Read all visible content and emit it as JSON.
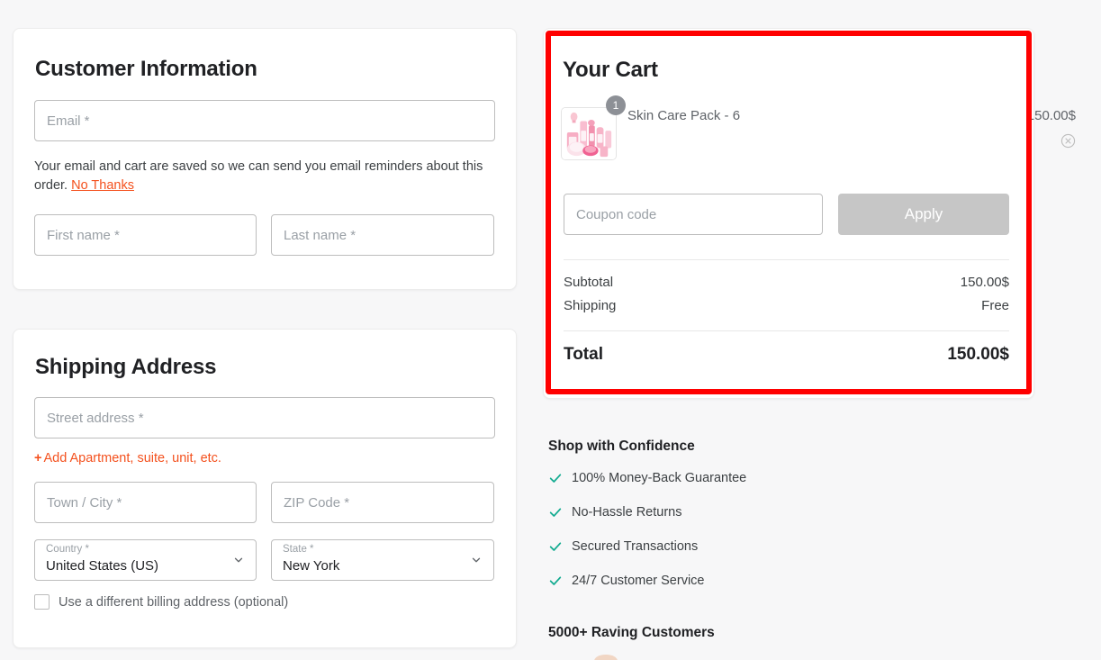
{
  "customer": {
    "title": "Customer Information",
    "email_placeholder": "Email *",
    "email_value": "",
    "help_text": "Your email and cart are saved so we can send you email reminders about this order. ",
    "help_link": "No Thanks",
    "first_name_placeholder": "First name *",
    "first_name_value": "",
    "last_name_placeholder": "Last name *",
    "last_name_value": ""
  },
  "shipping": {
    "title": "Shipping Address",
    "street_placeholder": "Street address *",
    "street_value": "",
    "add_apartment_label": "Add Apartment, suite, unit, etc.",
    "add_apartment_plus": "+",
    "city_placeholder": "Town / City *",
    "city_value": "",
    "zip_placeholder": "ZIP Code *",
    "zip_value": "",
    "country_label": "Country *",
    "country_value": "United States (US)",
    "state_label": "State *",
    "state_value": "New York",
    "billing_checkbox_label": "Use a different billing address (optional)",
    "billing_checked": false
  },
  "cart": {
    "title": "Your Cart",
    "items": [
      {
        "name": "Skin Care Pack - 6",
        "price": "150.00$",
        "quantity": "1",
        "remove_label": "remove-item"
      }
    ],
    "coupon_placeholder": "Coupon code",
    "coupon_value": "",
    "apply_label": "Apply",
    "summary": [
      {
        "label": "Subtotal",
        "value": "150.00$"
      },
      {
        "label": "Shipping",
        "value": "Free"
      }
    ],
    "total_label": "Total",
    "total_value": "150.00$",
    "highlight_color": "#ff0000"
  },
  "trust": {
    "title": "Shop with Confidence",
    "items": [
      "100% Money-Back Guarantee",
      "No-Hassle Returns",
      "Secured Transactions",
      "24/7 Customer Service"
    ],
    "check_color": "#12ab90"
  },
  "reviews": {
    "title": "5000+ Raving Customers"
  }
}
